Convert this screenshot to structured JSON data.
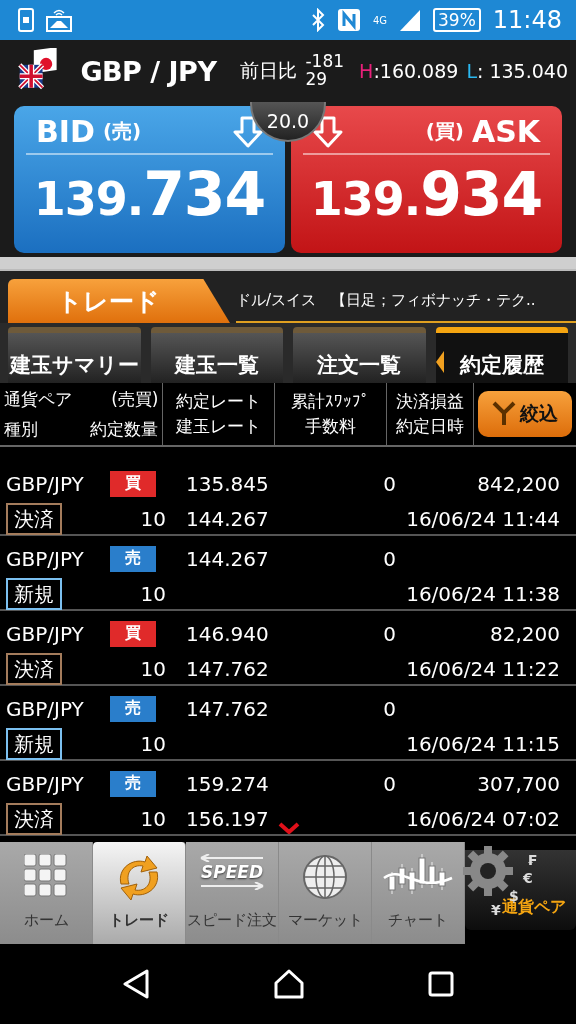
{
  "status_bar": {
    "network": "4G",
    "battery": "39%",
    "time": "11:48"
  },
  "header": {
    "pair": "GBP / JPY",
    "change_label": "前日比",
    "change_value": "-18129",
    "high_label": "H",
    "high_value": ":160.089",
    "low_label": "L",
    "low_value": ": 135.040"
  },
  "quotes": {
    "bid": {
      "label": "BID",
      "side": "(売)",
      "price_main": "139.",
      "price_pips": "734"
    },
    "spread": "20.0",
    "ask": {
      "label": "ASK",
      "side": "(買)",
      "price_main": "139.",
      "price_pips": "934"
    }
  },
  "trade_bar": {
    "title": "トレード",
    "ticker": "ドル/スイス　【日足；フィボナッチ・テク.."
  },
  "tabs": [
    {
      "label": "建玉サマリー",
      "selected": false
    },
    {
      "label": "建玉一覧",
      "selected": false
    },
    {
      "label": "注文一覧",
      "selected": false
    },
    {
      "label": "約定履歴",
      "selected": true
    }
  ],
  "columns": [
    [
      "通貨ペア",
      "(売買)",
      "種別",
      "約定数量"
    ],
    [
      "約定レート",
      "建玉レート"
    ],
    [
      "累計ｽﾜｯﾌﾟ",
      "手数料"
    ],
    [
      "決済損益",
      "約定日時"
    ]
  ],
  "filter_button": "絞込",
  "rows": [
    {
      "pair": "GBP/JPY",
      "side": {
        "label": "買",
        "kind": "buy"
      },
      "order_type": {
        "label": "決済",
        "kind": "close"
      },
      "quantity": "10",
      "rate": "135.845",
      "position_rate": "144.267",
      "swap": "0",
      "pnl": "842,200",
      "datetime": "16/06/24 11:44"
    },
    {
      "pair": "GBP/JPY",
      "side": {
        "label": "売",
        "kind": "sell"
      },
      "order_type": {
        "label": "新規",
        "kind": "new"
      },
      "quantity": "10",
      "rate": "144.267",
      "swap": "0",
      "datetime": "16/06/24 11:38"
    },
    {
      "pair": "GBP/JPY",
      "side": {
        "label": "買",
        "kind": "buy"
      },
      "order_type": {
        "label": "決済",
        "kind": "close"
      },
      "quantity": "10",
      "rate": "146.940",
      "position_rate": "147.762",
      "swap": "0",
      "pnl": "82,200",
      "datetime": "16/06/24 11:22"
    },
    {
      "pair": "GBP/JPY",
      "side": {
        "label": "売",
        "kind": "sell"
      },
      "order_type": {
        "label": "新規",
        "kind": "new"
      },
      "quantity": "10",
      "rate": "147.762",
      "swap": "0",
      "datetime": "16/06/24 11:15"
    },
    {
      "pair": "GBP/JPY",
      "side": {
        "label": "売",
        "kind": "sell"
      },
      "order_type": {
        "label": "決済",
        "kind": "close"
      },
      "quantity": "10",
      "rate": "159.274",
      "position_rate": "156.197",
      "swap": "0",
      "pnl": "307,700",
      "datetime": "16/06/24 07:02"
    }
  ],
  "bottom_nav": [
    {
      "label": "ホーム",
      "kind": "home",
      "selected": false
    },
    {
      "label": "トレード",
      "kind": "trade",
      "selected": true
    },
    {
      "label": "スピード注文",
      "kind": "speed",
      "icon_text": "SPEED",
      "selected": false
    },
    {
      "label": "マーケット",
      "kind": "market",
      "selected": false
    },
    {
      "label": "チャート",
      "kind": "chart",
      "selected": false
    }
  ],
  "currency_button": {
    "label": "通貨ペア",
    "symbols": [
      "₣",
      "€",
      "$",
      "¥"
    ]
  }
}
